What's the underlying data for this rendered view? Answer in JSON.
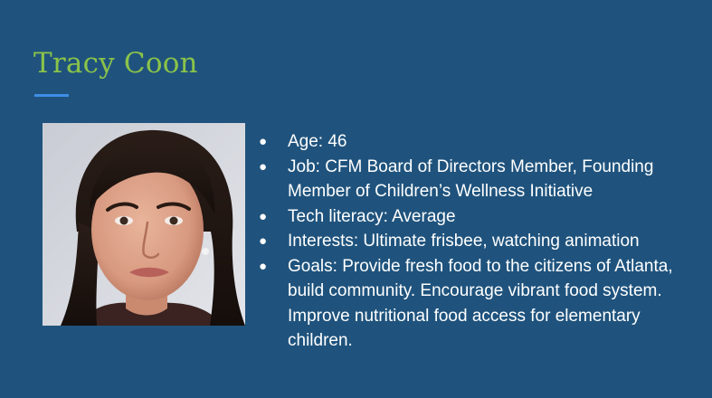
{
  "slide": {
    "title": "Tracy Coon",
    "colors": {
      "background": "#1f537d",
      "title": "#8bc34a",
      "underline": "#3d8ee6",
      "text": "#ffffff"
    }
  },
  "portrait": {
    "description_icon": "person-photo"
  },
  "bullets": [
    {
      "text": "Age: 46"
    },
    {
      "text": "Job: CFM Board of Directors Member, Founding Member of Children’s Wellness Initiative"
    },
    {
      "text": "Tech literacy: Average"
    },
    {
      "text": "Interests: Ultimate frisbee, watching animation"
    },
    {
      "text": "Goals: Provide fresh food to the citizens of Atlanta, build community. Encourage vibrant food system. Improve nutritional food access for elementary children."
    }
  ],
  "bullet_glyph": "●"
}
